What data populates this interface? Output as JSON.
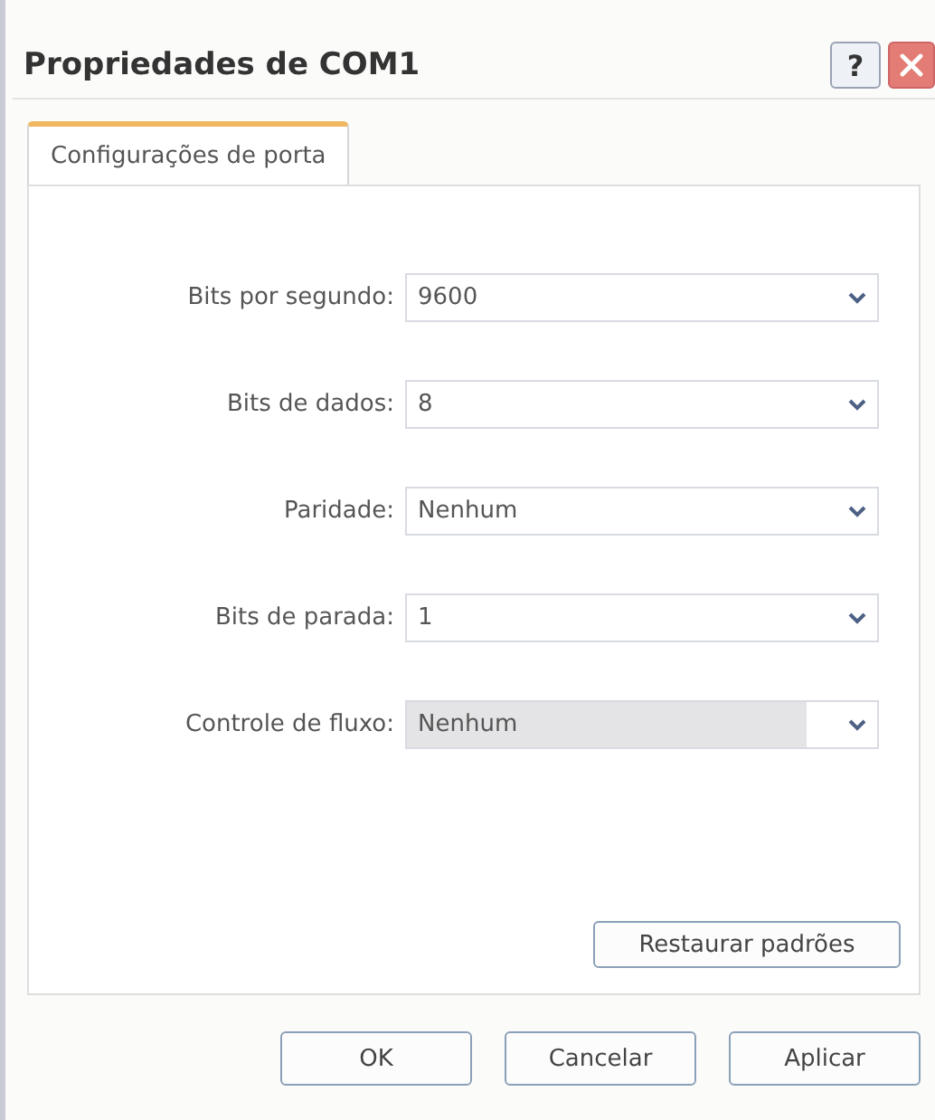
{
  "window": {
    "title": "Propriedades de COM1",
    "help_button": "?"
  },
  "tabs": [
    {
      "label": "Configurações de porta",
      "selected": true
    }
  ],
  "fields": [
    {
      "label": "Bits por segundo:",
      "value": "9600",
      "highlighted": false
    },
    {
      "label": "Bits de dados:",
      "value": "8",
      "highlighted": false
    },
    {
      "label": "Paridade:",
      "value": "Nenhum",
      "highlighted": false
    },
    {
      "label": "Bits de parada:",
      "value": "1",
      "highlighted": false
    },
    {
      "label": "Controle de fluxo:",
      "value": "Nenhum",
      "highlighted": true
    }
  ],
  "restore_button": "Restaurar padrões",
  "buttons": [
    "OK",
    "Cancelar",
    "Aplicar"
  ]
}
